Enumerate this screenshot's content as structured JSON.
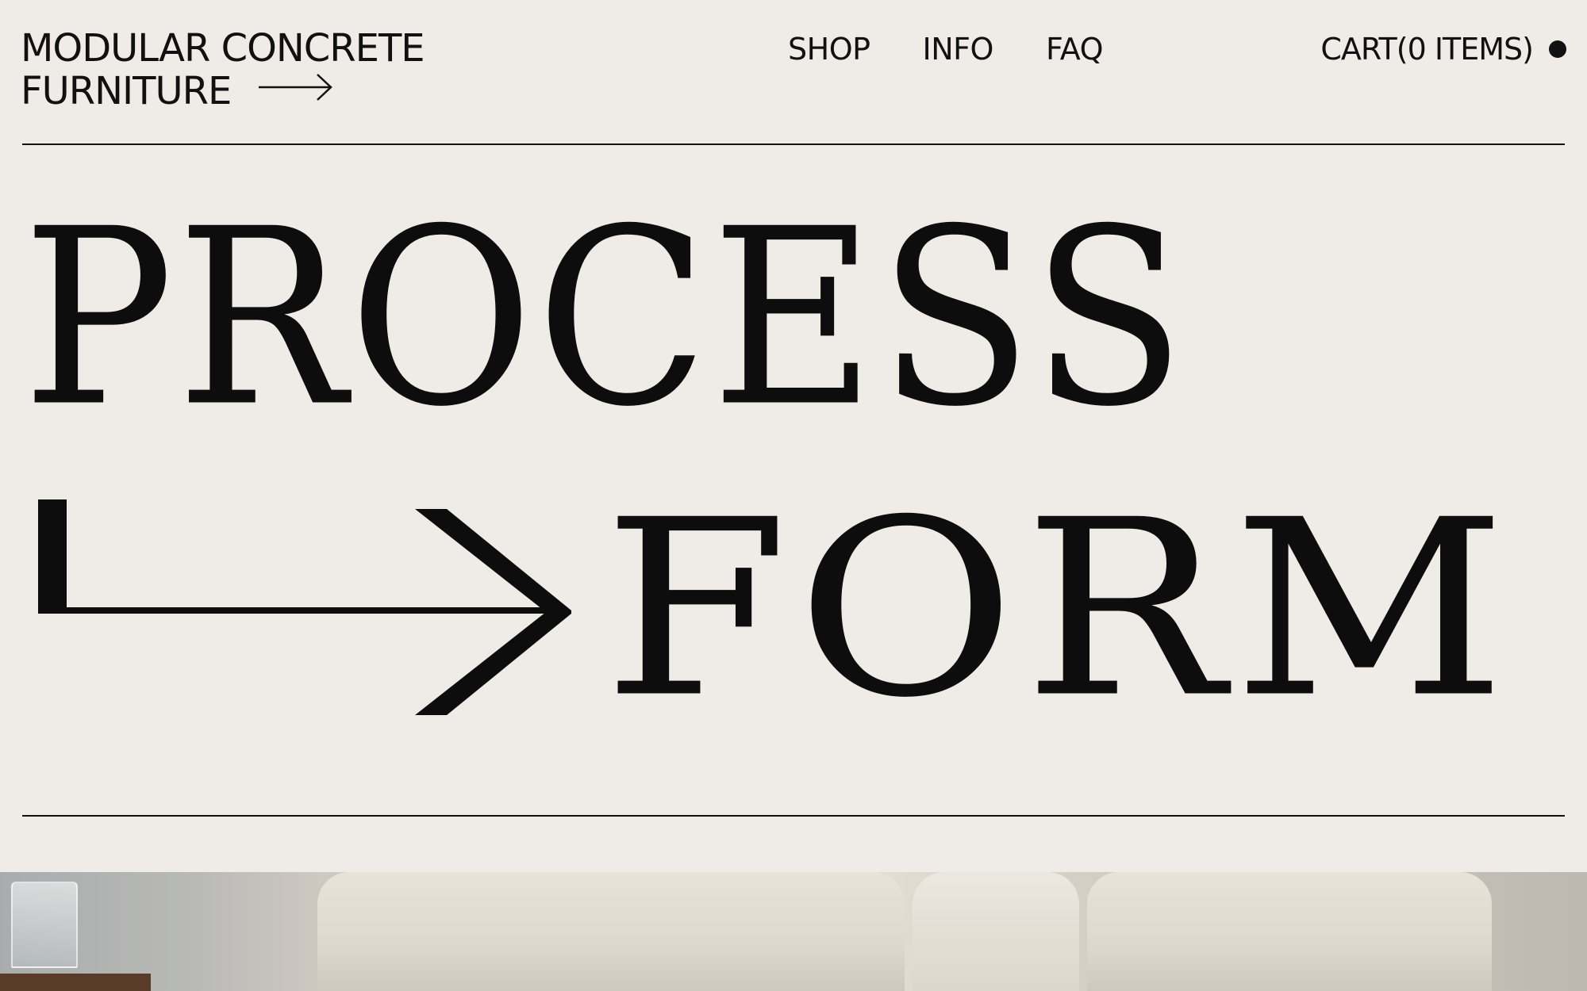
{
  "header": {
    "brand_line1": "MODULAR CONCRETE",
    "brand_line2": "FURNITURE",
    "nav": [
      {
        "label": "SHOP"
      },
      {
        "label": "INFO"
      },
      {
        "label": "FAQ"
      }
    ],
    "cart_label": "CART(0 ITEMS)"
  },
  "hero": {
    "line1": "PROCESS",
    "line2": "FORM"
  },
  "colors": {
    "background": "#efebe6",
    "ink": "#111111"
  },
  "icons": {
    "brand_arrow": "arrow-right-icon",
    "cart_status": "dot-icon",
    "hero_arrow": "elbow-arrow-icon"
  }
}
